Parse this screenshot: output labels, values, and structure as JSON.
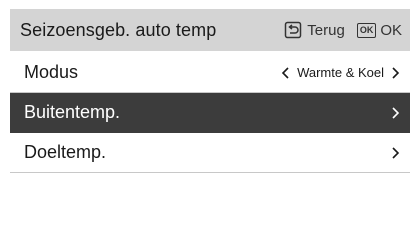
{
  "header": {
    "title": "Seizoensgeb. auto temp",
    "back_label": "Terug",
    "ok_badge": "OK",
    "ok_label": "OK",
    "back_icon": "back-arrow-icon",
    "ok_icon": "ok-key-icon"
  },
  "rows": [
    {
      "label": "Modus",
      "value": "Warmte & Koel",
      "selected": false
    },
    {
      "label": "Buitentemp.",
      "value": "",
      "selected": true
    },
    {
      "label": "Doeltemp.",
      "value": "",
      "selected": false
    }
  ],
  "colors": {
    "header_bg": "#d4d4d4",
    "selected_bg": "#3c3c3c",
    "divider": "#c8c8c8"
  }
}
